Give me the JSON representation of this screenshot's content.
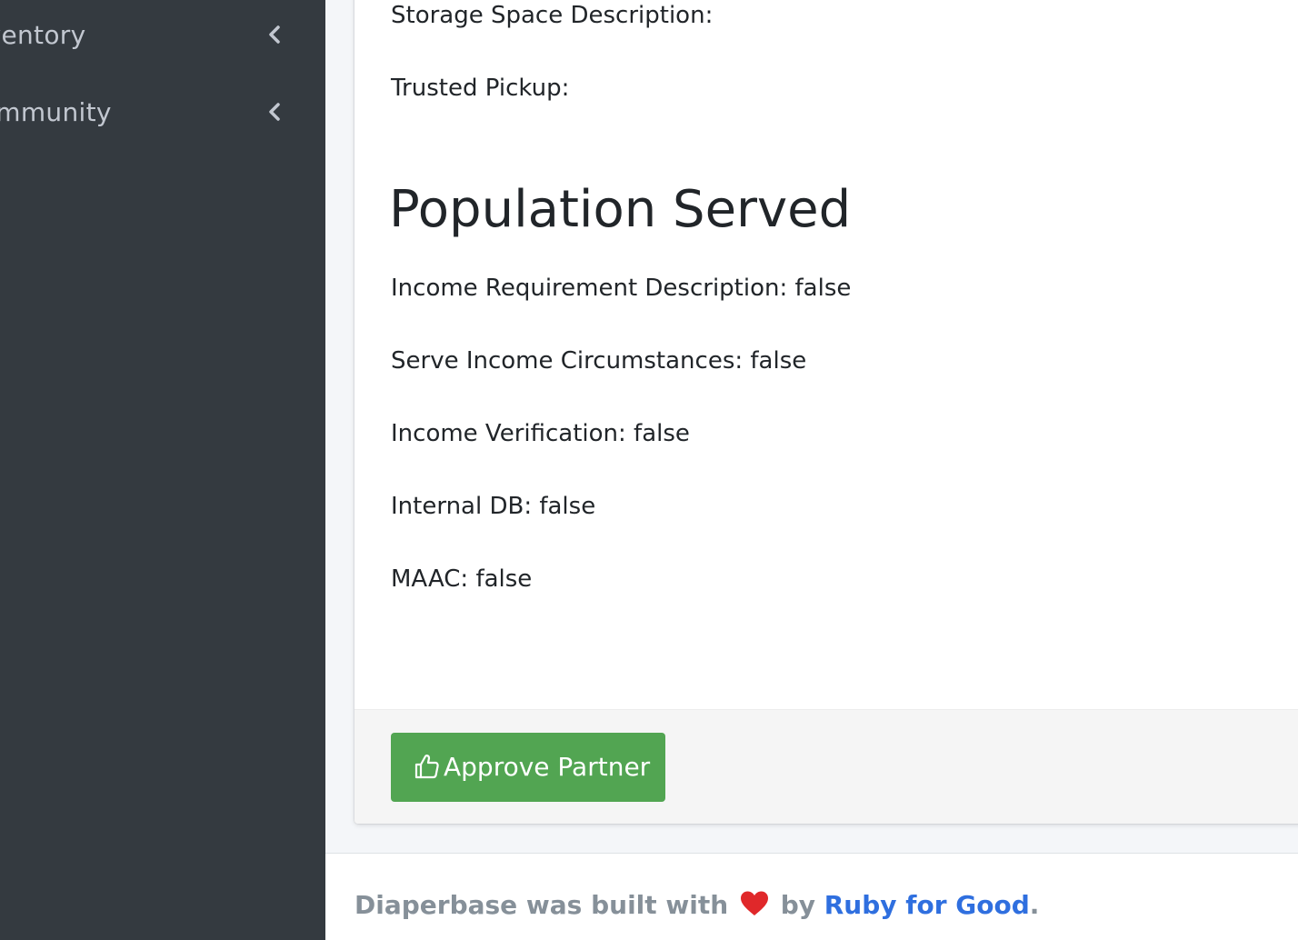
{
  "sidebar": {
    "items": [
      {
        "label": "Inventory",
        "icon": "chevron-left-icon"
      },
      {
        "label": "Community",
        "icon": "chevron-left-icon"
      }
    ]
  },
  "card": {
    "fields_top": [
      {
        "text": "Storage Space Description:"
      },
      {
        "text": "Trusted Pickup:"
      }
    ],
    "population_section": {
      "title": "Population Served",
      "fields": [
        {
          "text": "Income Requirement Description: false"
        },
        {
          "text": "Serve Income Circumstances: false"
        },
        {
          "text": "Income Verification: false"
        },
        {
          "text": "Internal DB: false"
        },
        {
          "text": "MAAC: false"
        }
      ]
    },
    "approve_button": {
      "label": "Approve Partner",
      "icon": "thumbs-up-icon",
      "color": "#52a552"
    }
  },
  "footer": {
    "prefix": "Diaperbase was built with",
    "middle": "by",
    "link_text": "Ruby for Good",
    "suffix": ".",
    "heart_icon": "heart-icon",
    "heart_color": "#e0282a",
    "link_color": "#2f6fdf"
  }
}
